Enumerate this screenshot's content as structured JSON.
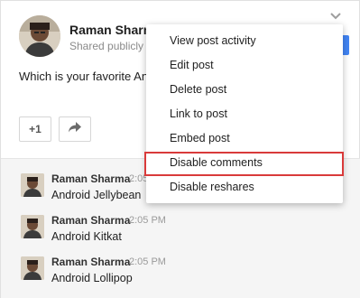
{
  "post": {
    "author": "Raman Sharma",
    "visibility": "Shared publicly",
    "visibility_sep": "·",
    "text": "Which is your favorite Android",
    "plus_one": "+1",
    "blue_partial": "d"
  },
  "menu": {
    "items": [
      "View post activity",
      "Edit post",
      "Delete post",
      "Link to post",
      "Embed post",
      "Disable comments",
      "Disable reshares"
    ],
    "highlighted": "Disable comments",
    "highlight_color": "#d93a3a"
  },
  "comments": [
    {
      "author": "Raman Sharma",
      "time": "2:05 PM",
      "text": "Android Jellybean"
    },
    {
      "author": "Raman Sharma",
      "time": "2:05 PM",
      "text": "Android Kitkat"
    },
    {
      "author": "Raman Sharma",
      "time": "2:05 PM",
      "text": "Android Lollipop"
    }
  ],
  "icons": {
    "post_menu": "chevron-down-icon",
    "share": "share-arrow-icon"
  },
  "colors": {
    "accent": "#4285f4",
    "comments_bg": "#f5f5f5"
  }
}
